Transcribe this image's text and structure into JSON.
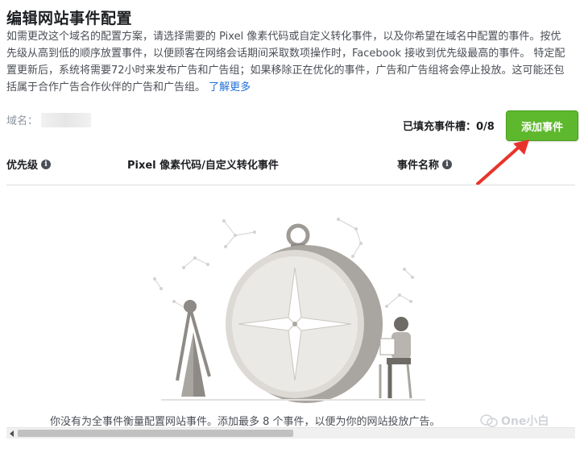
{
  "page": {
    "title": "编辑网站事件配置",
    "description": "如需更改这个域名的配置方案，请选择需要的 Pixel 像素代码或自定义转化事件，以及你希望在域名中配置的事件。按优先级从高到低的顺序放置事件，以便顾客在网络会话期间采取数项操作时，Facebook 接收到优先级最高的事件。 特定配置更新后，系统将需要72小时来发布广告和广告组；如果移除正在优化的事件，广告和广告组将会停止投放。这可能还包括属于合作广告合作伙伴的广告和广告组。",
    "learn_more": "了解更多"
  },
  "domain": {
    "label": "域名："
  },
  "slots": {
    "text": "已填充事件槽：0/8"
  },
  "add_button": {
    "label": "添加事件"
  },
  "columns": {
    "priority": "优先级",
    "pixel": "Pixel 像素代码/自定义转化事件",
    "event_name": "事件名称"
  },
  "empty_state": {
    "text": "你没有为全事件衡量配置网站事件。添加最多 8 个事件，以便为你的网站投放广告。"
  },
  "watermark": {
    "text": "One小白"
  },
  "colors": {
    "accent_green": "#5eb82d",
    "link_blue": "#216fdb",
    "annotation_red": "#e8332a"
  },
  "icons": [
    "info-icon",
    "arrow-annotation",
    "compass-illustration",
    "wechat-icon"
  ]
}
